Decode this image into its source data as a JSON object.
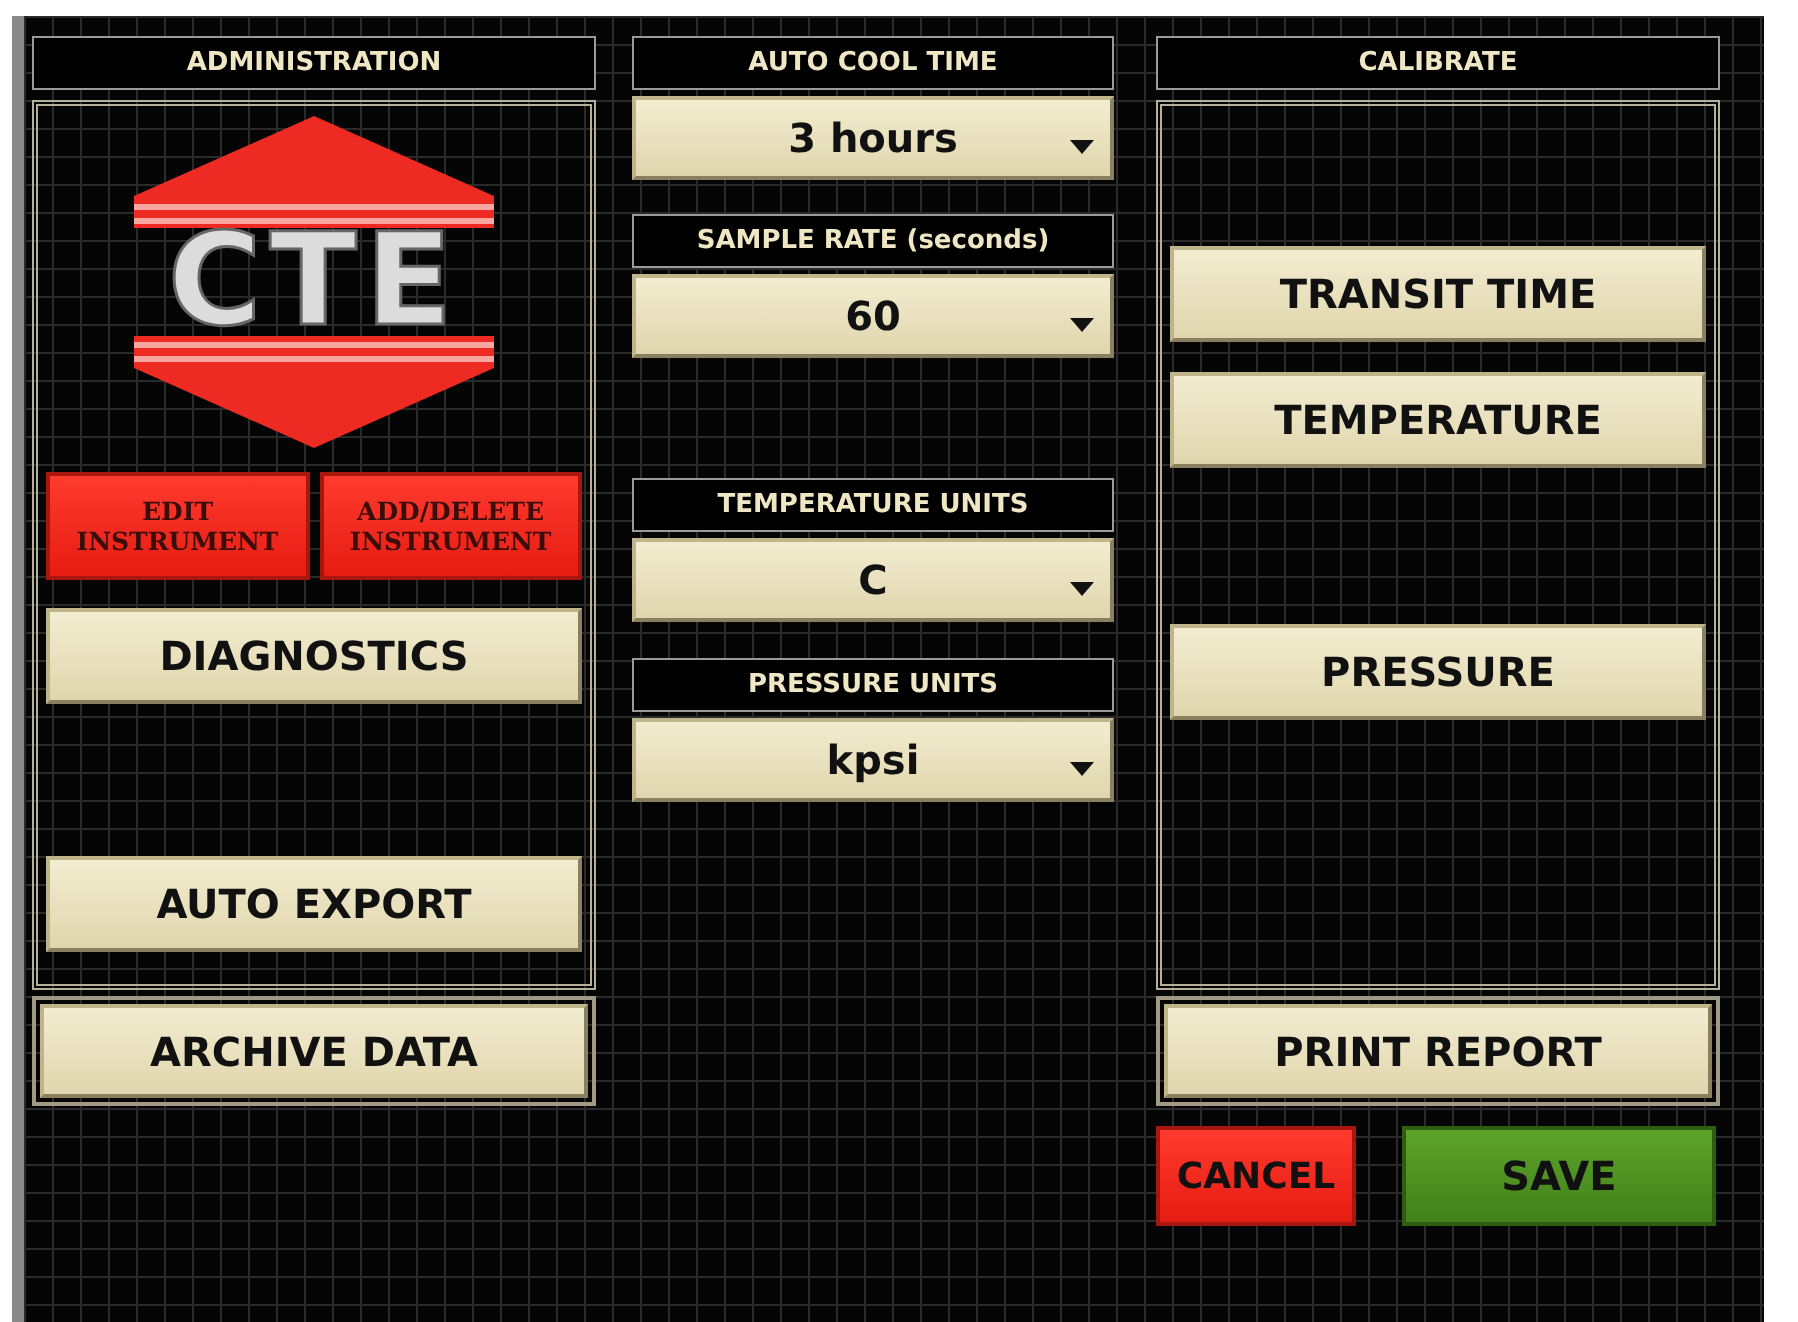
{
  "administration": {
    "title": "ADMINISTRATION",
    "logo": "CTE",
    "instrument_buttons": [
      {
        "lines": [
          "EDIT",
          "INSTRUMENT"
        ]
      },
      {
        "lines": [
          "ADD/DELETE",
          "INSTRUMENT"
        ]
      }
    ],
    "buttons": [
      "DIAGNOSTICS",
      "AUTO EXPORT"
    ],
    "archive_button": "ARCHIVE DATA"
  },
  "settings": [
    {
      "label": "AUTO COOL TIME",
      "value": "3 hours"
    },
    {
      "label": "SAMPLE RATE (seconds)",
      "value": "60"
    },
    {
      "label": "TEMPERATURE UNITS",
      "value": "C"
    },
    {
      "label": "PRESSURE UNITS",
      "value": "kpsi"
    }
  ],
  "calibrate": {
    "title": "CALIBRATE",
    "buttons": [
      "TRANSIT TIME",
      "TEMPERATURE",
      "PRESSURE"
    ],
    "print_button": "PRINT REPORT"
  },
  "actions": [
    {
      "label": "CANCEL",
      "kind": "cancel"
    },
    {
      "label": "SAVE",
      "kind": "save"
    }
  ]
}
